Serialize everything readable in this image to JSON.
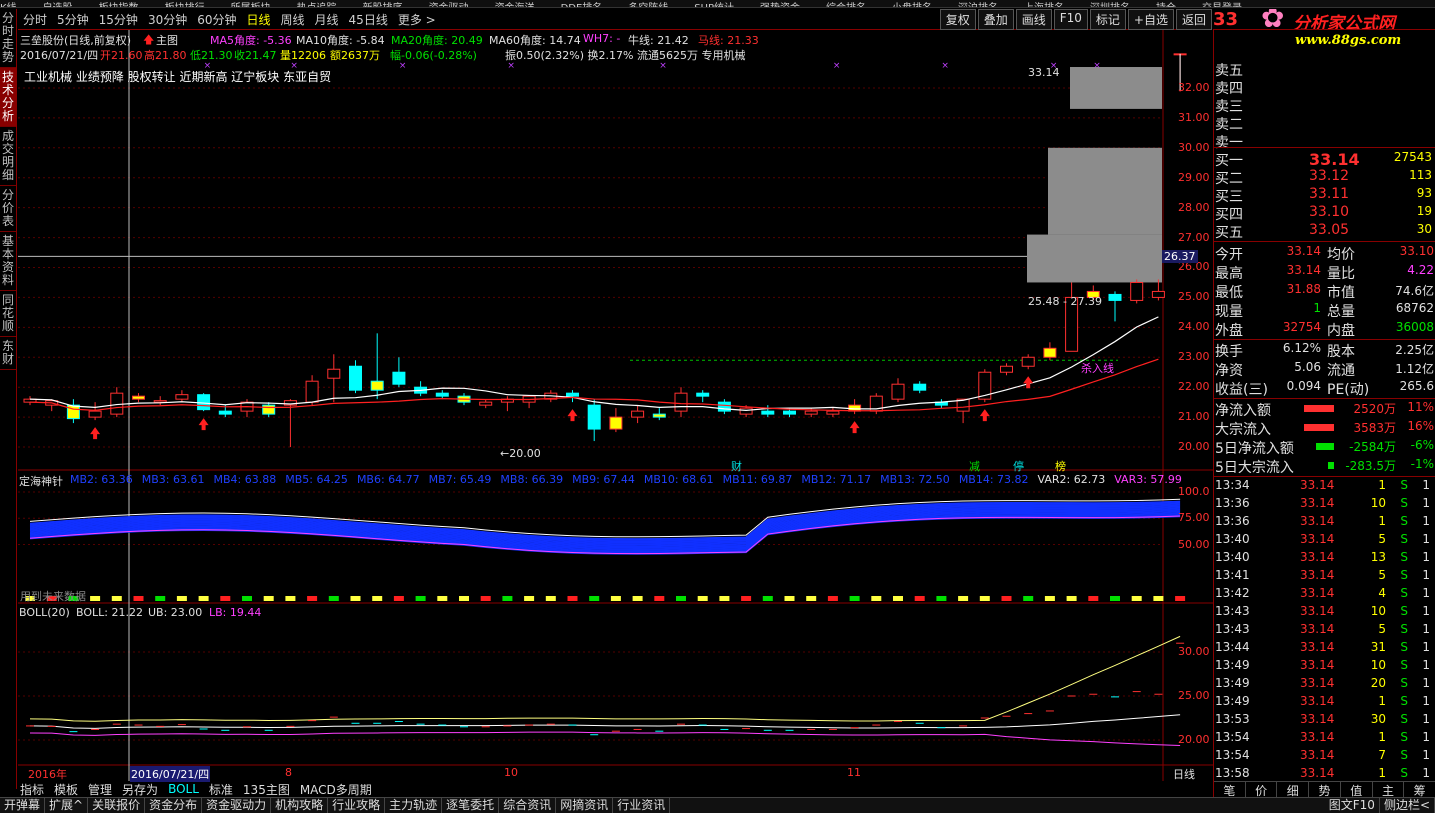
{
  "top_menu": [
    "K线",
    "自选股",
    "板块指数",
    "板块排行",
    "所属板块",
    "热点追踪",
    "新股排序",
    "资金驱动",
    "资金海洋",
    "DDE排名",
    "多空阵线",
    "SUP统计",
    "强势资金",
    "综合排名",
    "小盘排名",
    "深沪排名",
    "上海排名",
    "深圳排名",
    "持仓",
    "交易登录"
  ],
  "timeframes": {
    "items": [
      "分时",
      "5分钟",
      "15分钟",
      "30分钟",
      "60分钟",
      "日线",
      "周线",
      "月线",
      "45日线",
      "更多 >"
    ],
    "active": "日线"
  },
  "toolbar": [
    "复权",
    "叠加",
    "画线",
    "F10",
    "标记",
    "+自选",
    "返回"
  ],
  "left_tabs": [
    {
      "label": "分时走势",
      "active": false
    },
    {
      "label": "技术分析",
      "active": true
    },
    {
      "label": "成交明细",
      "active": false
    },
    {
      "label": "分价表",
      "active": false
    },
    {
      "label": "基本资料",
      "active": false
    },
    {
      "label": "同花顺",
      "active": false
    },
    {
      "label": "东财",
      "active": false
    }
  ],
  "main": {
    "stock_title": "三垒股份(日线,前复权)",
    "main_chart_label": "主图",
    "ma": {
      "ma5": "MA5角度: -5.36",
      "ma10": "MA10角度: -5.84",
      "ma20": "MA20角度: 20.49",
      "ma60": "MA60角度: 14.74",
      "wh": "WH7: -",
      "bull": "牛线: 21.42",
      "horse": "马线: 21.33"
    },
    "ohlc_date": "2016/07/21/四",
    "ohlc_open": "开21.60",
    "ohlc_high": "高21.80",
    "ohlc_low": "低21.30",
    "ohlc_close": "收21.47",
    "ohlc_vol": "量12206",
    "ohlc_amount": "额2637万",
    "ohlc_change": "幅-0.06(-0.28%)",
    "ohlc_rest": "振0.50(2.32%) 换2.17% 流通5625万 专用机械",
    "tags": "工业机械 业绩预降 股权转让 近期新高 辽宁板块 东亚自贸",
    "price_axis": [
      "32.00",
      "31.00",
      "30.00",
      "29.00",
      "28.00",
      "27.00",
      "26.00",
      "25.00",
      "24.00",
      "23.00",
      "22.00",
      "21.00",
      "20.00"
    ],
    "crosshair_price": "26.37",
    "label_high": "33.14",
    "label_range": "25.48 - 27.39",
    "label_low": "←20.00",
    "kill_line": "杀入线",
    "event_tags": [
      "财",
      "减",
      "停",
      "榜"
    ]
  },
  "indicator1": {
    "name": "定海神针",
    "values": [
      {
        "label": "MB2: 63.36",
        "color": "blue"
      },
      {
        "label": "MB3: 63.61",
        "color": "blue"
      },
      {
        "label": "MB4: 63.88",
        "color": "blue"
      },
      {
        "label": "MB5: 64.25",
        "color": "blue"
      },
      {
        "label": "MB6: 64.77",
        "color": "blue"
      },
      {
        "label": "MB7: 65.49",
        "color": "blue"
      },
      {
        "label": "MB8: 66.39",
        "color": "blue"
      },
      {
        "label": "MB9: 67.44",
        "color": "blue"
      },
      {
        "label": "MB10: 68.61",
        "color": "blue"
      },
      {
        "label": "MB11: 69.87",
        "color": "blue"
      },
      {
        "label": "MB12: 71.17",
        "color": "blue"
      },
      {
        "label": "MB13: 72.50",
        "color": "blue"
      },
      {
        "label": "MB14: 73.82",
        "color": "blue"
      },
      {
        "label": "VAR2: 62.73",
        "color": "white"
      },
      {
        "label": "VAR3: 57.99",
        "color": "magenta"
      }
    ],
    "axis": [
      "100.0",
      "75.00",
      "50.00"
    ],
    "note": "用到未来数据"
  },
  "indicator2": {
    "name": "BOLL(20)",
    "boll": "BOLL: 21.22",
    "ub": "UB: 23.00",
    "lb": "LB: 19.44",
    "axis": [
      "30.00",
      "25.00",
      "20.00"
    ]
  },
  "date_axis": {
    "year": "2016年",
    "cursor": "2016/07/21/四",
    "months": [
      "8",
      "10",
      "11"
    ],
    "period": "日线"
  },
  "sub_tabs": {
    "items": [
      "指标",
      "模板",
      "管理",
      "另存为",
      "BOLL",
      "标准",
      "135主图",
      "MACD多周期"
    ],
    "active": "BOLL"
  },
  "bottom_bar": [
    "开弹幕",
    "扩展^",
    "关联报价",
    "资金分布",
    "资金驱动力",
    "机构攻略",
    "行业攻略",
    "主力轨迹",
    "逐笔委托",
    "综合资讯",
    "网摘资讯",
    "行业资讯"
  ],
  "bottom_right": [
    "图文F10",
    "侧边栏<"
  ],
  "right": {
    "top_price": "33",
    "logo": "分析家公式网",
    "logo_url": "www.88gs.com",
    "asks": [
      {
        "label": "卖五"
      },
      {
        "label": "卖四"
      },
      {
        "label": "卖三"
      },
      {
        "label": "卖二"
      },
      {
        "label": "卖一"
      }
    ],
    "bids": [
      {
        "label": "买一",
        "price": "33.14",
        "vol": "27543"
      },
      {
        "label": "买二",
        "price": "33.12",
        "vol": "113"
      },
      {
        "label": "买三",
        "price": "33.11",
        "vol": "93"
      },
      {
        "label": "买四",
        "price": "33.10",
        "vol": "19"
      },
      {
        "label": "买五",
        "price": "33.05",
        "vol": "30"
      }
    ],
    "stats": [
      {
        "l1": "今开",
        "v1": "33.14",
        "c1": "red",
        "l2": "均价",
        "v2": "33.10",
        "c2": "red"
      },
      {
        "l1": "最高",
        "v1": "33.14",
        "c1": "red",
        "l2": "量比",
        "v2": "4.22",
        "c2": "mag"
      },
      {
        "l1": "最低",
        "v1": "31.88",
        "c1": "red",
        "l2": "市值",
        "v2": "74.6亿",
        "c2": "wht"
      },
      {
        "l1": "现量",
        "v1": "1",
        "c1": "grn",
        "l2": "总量",
        "v2": "68762",
        "c2": "wht"
      },
      {
        "l1": "外盘",
        "v1": "32754",
        "c1": "red",
        "l2": "内盘",
        "v2": "36008",
        "c2": "grn"
      }
    ],
    "fund": [
      {
        "l1": "换手",
        "v1": "6.12%",
        "l2": "股本",
        "v2": "2.25亿"
      },
      {
        "l1": "净资",
        "v1": "5.06",
        "l2": "流通",
        "v2": "1.12亿"
      },
      {
        "l1": "收益(三)",
        "v1": "0.094",
        "l2": "PE(动)",
        "v2": "265.6"
      }
    ],
    "flows": [
      {
        "label": "净流入额",
        "value": "2520万",
        "pct": "11%",
        "color": "red",
        "bar": 1
      },
      {
        "label": "大宗流入",
        "value": "3583万",
        "pct": "16%",
        "color": "red",
        "bar": 1
      },
      {
        "label": "5日净流入额",
        "value": "-2584万",
        "pct": "-6%",
        "color": "grn",
        "bar": 0.6
      },
      {
        "label": "5日大宗流入",
        "value": "-283.5万",
        "pct": "-1%",
        "color": "grn",
        "bar": 0.2
      }
    ],
    "ticks": [
      {
        "time": "13:34",
        "price": "33.14",
        "vol": "1",
        "bs": "S",
        "n": "1"
      },
      {
        "time": "13:36",
        "price": "33.14",
        "vol": "10",
        "bs": "S",
        "n": "1"
      },
      {
        "time": "13:36",
        "price": "33.14",
        "vol": "1",
        "bs": "S",
        "n": "1"
      },
      {
        "time": "13:40",
        "price": "33.14",
        "vol": "5",
        "bs": "S",
        "n": "1"
      },
      {
        "time": "13:40",
        "price": "33.14",
        "vol": "13",
        "bs": "S",
        "n": "1"
      },
      {
        "time": "13:41",
        "price": "33.14",
        "vol": "5",
        "bs": "S",
        "n": "1"
      },
      {
        "time": "13:42",
        "price": "33.14",
        "vol": "4",
        "bs": "S",
        "n": "1"
      },
      {
        "time": "13:43",
        "price": "33.14",
        "vol": "10",
        "bs": "S",
        "n": "1"
      },
      {
        "time": "13:43",
        "price": "33.14",
        "vol": "5",
        "bs": "S",
        "n": "1"
      },
      {
        "time": "13:44",
        "price": "33.14",
        "vol": "31",
        "bs": "S",
        "n": "1"
      },
      {
        "time": "13:49",
        "price": "33.14",
        "vol": "10",
        "bs": "S",
        "n": "1"
      },
      {
        "time": "13:49",
        "price": "33.14",
        "vol": "20",
        "bs": "S",
        "n": "1"
      },
      {
        "time": "13:49",
        "price": "33.14",
        "vol": "1",
        "bs": "S",
        "n": "1"
      },
      {
        "time": "13:53",
        "price": "33.14",
        "vol": "30",
        "bs": "S",
        "n": "1"
      },
      {
        "time": "13:54",
        "price": "33.14",
        "vol": "1",
        "bs": "S",
        "n": "1"
      },
      {
        "time": "13:54",
        "price": "33.14",
        "vol": "7",
        "bs": "S",
        "n": "1"
      },
      {
        "time": "13:58",
        "price": "33.14",
        "vol": "1",
        "bs": "S",
        "n": "1"
      }
    ],
    "bottom_tabs": [
      "笔",
      "价",
      "细",
      "势",
      "值",
      "主",
      "筹"
    ]
  },
  "candles": [
    {
      "o": 21.5,
      "h": 21.7,
      "l": 21.4,
      "c": 21.6
    },
    {
      "o": 21.4,
      "h": 21.6,
      "l": 21.2,
      "c": 21.55
    },
    {
      "o": 21.4,
      "h": 21.6,
      "l": 20.8,
      "c": 20.95
    },
    {
      "o": 21.0,
      "h": 21.5,
      "l": 20.9,
      "c": 21.2
    },
    {
      "o": 21.1,
      "h": 22.0,
      "l": 21.0,
      "c": 21.8
    },
    {
      "o": 21.6,
      "h": 21.8,
      "l": 21.5,
      "c": 21.7
    },
    {
      "o": 21.5,
      "h": 21.7,
      "l": 21.4,
      "c": 21.55
    },
    {
      "o": 21.6,
      "h": 21.9,
      "l": 21.5,
      "c": 21.75
    },
    {
      "o": 21.75,
      "h": 21.8,
      "l": 21.2,
      "c": 21.25
    },
    {
      "o": 21.2,
      "h": 21.4,
      "l": 21.0,
      "c": 21.1
    },
    {
      "o": 21.2,
      "h": 21.6,
      "l": 21.0,
      "c": 21.5
    },
    {
      "o": 21.4,
      "h": 21.5,
      "l": 21.0,
      "c": 21.1
    },
    {
      "o": 21.4,
      "h": 21.6,
      "l": 20.0,
      "c": 21.55
    },
    {
      "o": 21.5,
      "h": 22.4,
      "l": 21.4,
      "c": 22.2
    },
    {
      "o": 22.3,
      "h": 23.1,
      "l": 21.5,
      "c": 22.6
    },
    {
      "o": 22.7,
      "h": 22.9,
      "l": 21.8,
      "c": 21.9
    },
    {
      "o": 22.2,
      "h": 23.8,
      "l": 21.6,
      "c": 21.9
    },
    {
      "o": 22.5,
      "h": 23.0,
      "l": 22.0,
      "c": 22.1
    },
    {
      "o": 22.0,
      "h": 22.2,
      "l": 21.7,
      "c": 21.8
    },
    {
      "o": 21.8,
      "h": 21.9,
      "l": 21.6,
      "c": 21.7
    },
    {
      "o": 21.7,
      "h": 21.8,
      "l": 21.4,
      "c": 21.5
    },
    {
      "o": 21.4,
      "h": 21.6,
      "l": 21.3,
      "c": 21.5
    },
    {
      "o": 21.5,
      "h": 21.7,
      "l": 21.2,
      "c": 21.6
    },
    {
      "o": 21.5,
      "h": 21.7,
      "l": 21.3,
      "c": 21.7
    },
    {
      "o": 21.6,
      "h": 21.9,
      "l": 21.5,
      "c": 21.8
    },
    {
      "o": 21.8,
      "h": 21.9,
      "l": 21.5,
      "c": 21.7
    },
    {
      "o": 21.4,
      "h": 21.6,
      "l": 20.2,
      "c": 20.6
    },
    {
      "o": 20.6,
      "h": 21.3,
      "l": 20.5,
      "c": 21.0
    },
    {
      "o": 21.0,
      "h": 21.4,
      "l": 20.8,
      "c": 21.2
    },
    {
      "o": 21.1,
      "h": 21.3,
      "l": 20.9,
      "c": 21.0
    },
    {
      "o": 21.2,
      "h": 22.0,
      "l": 21.0,
      "c": 21.8
    },
    {
      "o": 21.8,
      "h": 21.9,
      "l": 21.5,
      "c": 21.7
    },
    {
      "o": 21.5,
      "h": 21.6,
      "l": 21.1,
      "c": 21.2
    },
    {
      "o": 21.1,
      "h": 21.4,
      "l": 21.0,
      "c": 21.3
    },
    {
      "o": 21.2,
      "h": 21.4,
      "l": 21.0,
      "c": 21.1
    },
    {
      "o": 21.2,
      "h": 21.3,
      "l": 21.0,
      "c": 21.1
    },
    {
      "o": 21.1,
      "h": 21.3,
      "l": 21.0,
      "c": 21.2
    },
    {
      "o": 21.1,
      "h": 21.3,
      "l": 21.0,
      "c": 21.2
    },
    {
      "o": 21.2,
      "h": 21.6,
      "l": 21.1,
      "c": 21.4
    },
    {
      "o": 21.2,
      "h": 21.8,
      "l": 21.1,
      "c": 21.7
    },
    {
      "o": 21.6,
      "h": 22.3,
      "l": 21.5,
      "c": 22.1
    },
    {
      "o": 22.1,
      "h": 22.2,
      "l": 21.8,
      "c": 21.9
    },
    {
      "o": 21.5,
      "h": 21.6,
      "l": 21.3,
      "c": 21.4
    },
    {
      "o": 21.2,
      "h": 21.6,
      "l": 20.8,
      "c": 21.6
    },
    {
      "o": 21.6,
      "h": 22.6,
      "l": 21.5,
      "c": 22.5
    },
    {
      "o": 22.5,
      "h": 22.8,
      "l": 22.4,
      "c": 22.7
    },
    {
      "o": 22.7,
      "h": 23.1,
      "l": 22.6,
      "c": 23.0
    },
    {
      "o": 23.0,
      "h": 23.5,
      "l": 22.9,
      "c": 23.3
    },
    {
      "o": 23.2,
      "h": 25.5,
      "l": 23.2,
      "c": 25.0
    },
    {
      "o": 25.0,
      "h": 25.4,
      "l": 24.9,
      "c": 25.2
    },
    {
      "o": 25.1,
      "h": 25.2,
      "l": 24.2,
      "c": 24.9
    },
    {
      "o": 24.9,
      "h": 25.6,
      "l": 24.8,
      "c": 25.5
    },
    {
      "o": 25.0,
      "h": 25.6,
      "l": 24.9,
      "c": 25.2
    },
    {
      "o": 33.14,
      "h": 33.14,
      "l": 31.88,
      "c": 33.14
    }
  ]
}
